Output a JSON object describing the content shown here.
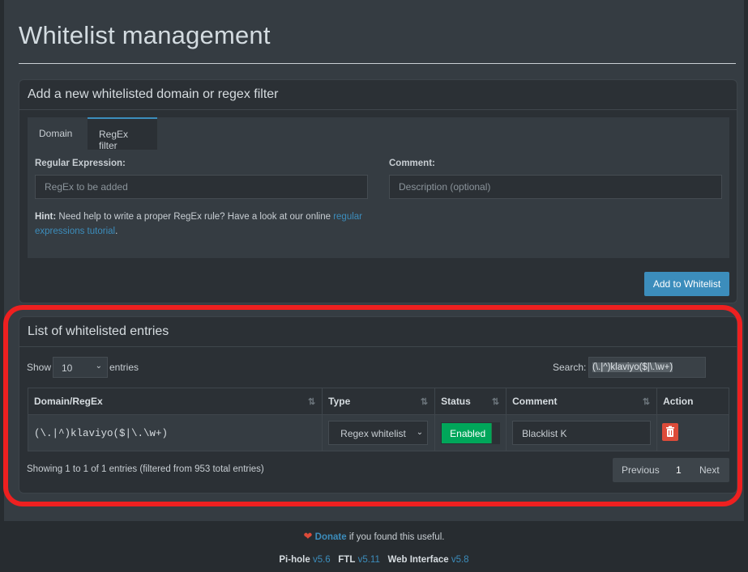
{
  "page": {
    "title": "Whitelist management"
  },
  "add_box": {
    "header": "Add a new whitelisted domain or regex filter",
    "tabs": [
      {
        "label": "Domain"
      },
      {
        "label": "RegEx filter"
      }
    ],
    "regex_label": "Regular Expression:",
    "regex_placeholder": "RegEx to be added",
    "comment_label": "Comment:",
    "comment_placeholder": "Description (optional)",
    "hint_bold": "Hint:",
    "hint_text": " Need help to write a proper RegEx rule? Have a look at our online ",
    "hint_link": "regular expressions tutorial",
    "hint_end": ".",
    "add_button": "Add to Whitelist"
  },
  "list_box": {
    "header": "List of whitelisted entries",
    "show_label": "Show",
    "page_size": "10",
    "entries_label": "entries",
    "search_label": "Search:",
    "search_value": "(\\.|^)klaviyo($|\\.\\w+)",
    "columns": [
      "Domain/RegEx",
      "Type",
      "Status",
      "Comment",
      "Action"
    ],
    "rows": [
      {
        "domain": "(\\.|^)klaviyo($|\\.\\w+)",
        "type": "Regex whitelist",
        "status": "Enabled",
        "comment": "Blacklist K"
      }
    ],
    "info": "Showing 1 to 1 of 1 entries (filtered from 953 total entries)",
    "pager": {
      "previous": "Previous",
      "current": "1",
      "next": "Next"
    }
  },
  "footer": {
    "donate": "Donate",
    "donate_suffix": " if you found this useful.",
    "pihole_label": "Pi-hole",
    "pihole_version": "v5.6",
    "ftl_label": "FTL",
    "ftl_version": "v5.11",
    "web_label": "Web Interface",
    "web_version": "v5.8"
  },
  "colors": {
    "accent": "#3c8dbc",
    "enabled": "#00a65a",
    "danger": "#dd4b39",
    "highlight": "#ee2020"
  }
}
